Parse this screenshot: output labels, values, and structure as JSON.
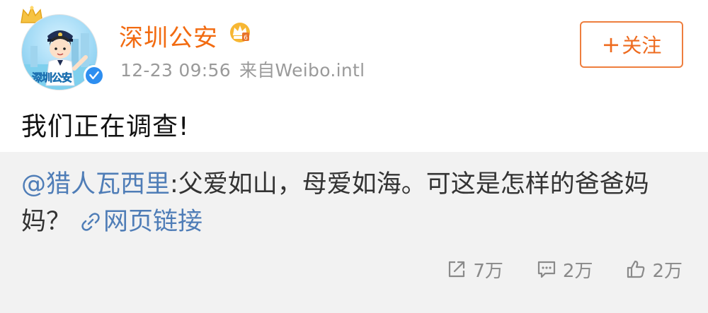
{
  "post": {
    "username": "深圳公安",
    "timestamp": "12-23 09:56",
    "source": "来自Weibo.intl",
    "follow_plus": "+",
    "follow_label": "关注",
    "avatar_caption": "深圳公安",
    "text": "我们正在调查!"
  },
  "repost": {
    "author": "@猎人瓦西里",
    "text": ":父爱如山，母爱如海。可这是怎样的爸爸妈妈？",
    "link_label": "网页链接"
  },
  "actions": {
    "share_count": "7万",
    "comment_count": "2万",
    "like_count": "2万"
  },
  "icons": {
    "crown": "crown-icon",
    "verified": "verified-icon",
    "vip": "vip-badge-icon",
    "link": "link-icon",
    "share": "share-icon",
    "comment": "comment-icon",
    "like": "like-icon"
  },
  "colors": {
    "username": "#f26b11",
    "follow_border": "#ee7e3e",
    "link": "#4f7db7",
    "repost_bg": "#f2f2f2",
    "meta": "#9a9a9a",
    "verified": "#2d8ef0"
  }
}
